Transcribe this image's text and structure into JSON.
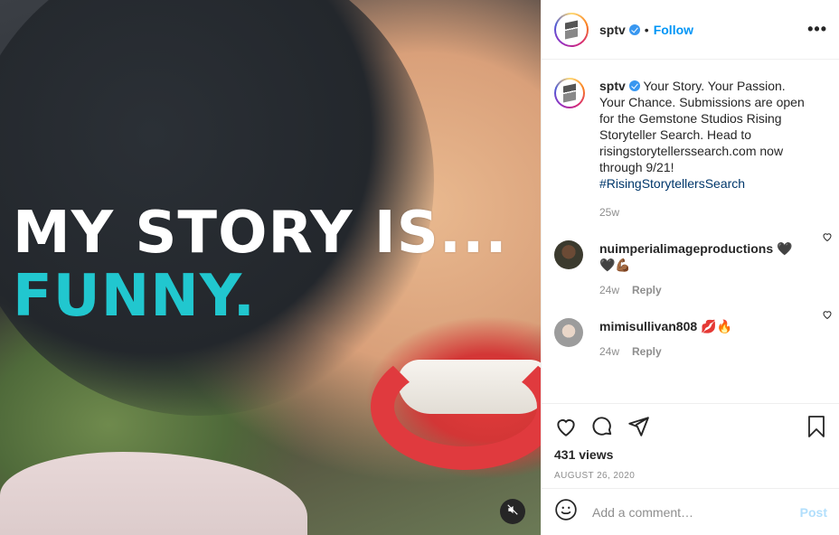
{
  "media": {
    "line1": "MY STORY IS...",
    "line2": "FUNNY.",
    "colors": {
      "line1": "#ffffff",
      "line2": "#21c7cf"
    }
  },
  "header": {
    "username": "sptv",
    "dot": "•",
    "follow_label": "Follow",
    "more_label": "•••"
  },
  "caption": {
    "username": "sptv",
    "text": "Your Story. Your Passion. Your Chance. Submissions are open for the Gemstone Studios Rising Storyteller Search. Head to risingstorytellerssearch.com now through 9/21!",
    "hashtag": "#RisingStorytellersSearch",
    "time": "25w"
  },
  "comments": [
    {
      "username": "nuimperialimageproductions",
      "text": "🖤🖤💪🏾",
      "time": "24w",
      "reply": "Reply"
    },
    {
      "username": "mimisullivan808",
      "text": "💋🔥",
      "time": "24w",
      "reply": "Reply"
    }
  ],
  "stats": {
    "views": "431 views",
    "date": "AUGUST 26, 2020"
  },
  "composer": {
    "placeholder": "Add a comment…",
    "post_label": "Post"
  },
  "brand": {
    "accent": "#0095f6",
    "hashtag": "#00376b"
  }
}
